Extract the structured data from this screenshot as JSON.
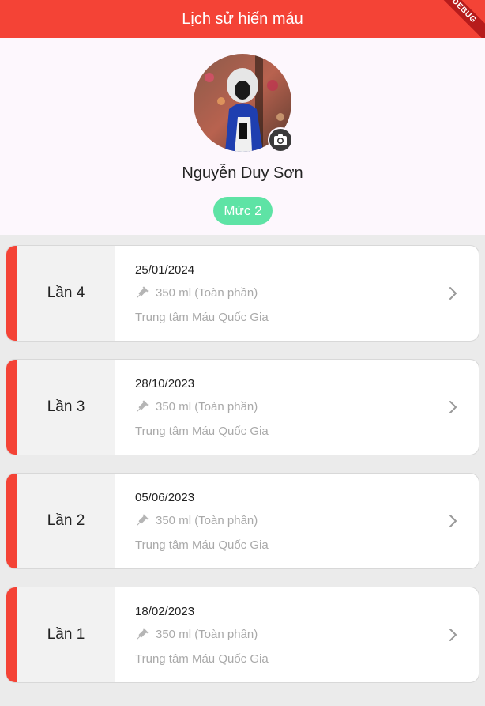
{
  "appbar": {
    "title": "Lịch sử hiến máu",
    "color": "#f44336"
  },
  "debug_banner": "DEBUG",
  "profile": {
    "name": "Nguyễn Duy Sơn",
    "level": "Mức 2",
    "level_color": "#5ee3a5"
  },
  "donations": [
    {
      "label": "Lần 4",
      "date": "25/01/2024",
      "volume": "350 ml (Toàn phần)",
      "center": "Trung tâm Máu Quốc Gia"
    },
    {
      "label": "Lần 3",
      "date": "28/10/2023",
      "volume": "350 ml (Toàn phần)",
      "center": "Trung tâm Máu Quốc Gia"
    },
    {
      "label": "Lần 2",
      "date": "05/06/2023",
      "volume": "350 ml (Toàn phần)",
      "center": "Trung tâm Máu Quốc Gia"
    },
    {
      "label": "Lần 1",
      "date": "18/02/2023",
      "volume": "350 ml (Toàn phần)",
      "center": "Trung tâm Máu Quốc Gia"
    }
  ],
  "icons": {
    "camera": "camera-icon",
    "syringe": "syringe-icon",
    "chevron": "chevron-right-icon"
  }
}
